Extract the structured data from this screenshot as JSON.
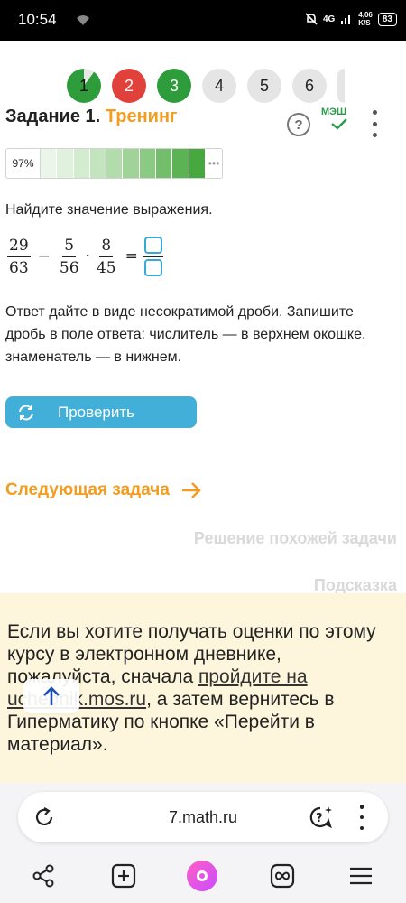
{
  "status_bar": {
    "time": "10:54",
    "network": "4G",
    "speed_top": "4,06",
    "speed_bottom": "K/S",
    "battery": "83"
  },
  "task_nav": {
    "items": [
      {
        "label": "1",
        "state": "current-partial"
      },
      {
        "label": "2",
        "state": "wrong"
      },
      {
        "label": "3",
        "state": "correct"
      },
      {
        "label": "4",
        "state": "pending"
      },
      {
        "label": "5",
        "state": "pending"
      },
      {
        "label": "6",
        "state": "pending"
      }
    ]
  },
  "header": {
    "task_label": "Задание 1.",
    "mode_label": "Тренинг",
    "help_symbol": "?",
    "badge_label": "МЭШ"
  },
  "progress": {
    "label": "97%",
    "value": 0.97,
    "cell_colors": [
      "#eaf6ea",
      "#e0f1de",
      "#d3ebcf",
      "#c4e4bf",
      "#b2dcac",
      "#9fd398",
      "#8bca83",
      "#72be6a",
      "#5bb353",
      "#46a83f"
    ],
    "more": "•••"
  },
  "task": {
    "prompt": "Найдите значение выражения.",
    "expression": {
      "f1_num": "29",
      "f1_den": "63",
      "op1": "−",
      "f2_num": "5",
      "f2_den": "56",
      "op2": "·",
      "f3_num": "8",
      "f3_den": "45",
      "eq": "="
    },
    "instructions": "Ответ дайте в виде несократимой дроби. Запишите дробь в поле ответа: числитель — в верхнем окошке, знаменатель — в нижнем."
  },
  "actions": {
    "check_label": "Проверить",
    "next_label": "Следующая задача",
    "similar_label": "Решение похожей задачи",
    "hint_label": "Подсказка"
  },
  "notice": {
    "text_before": "Если вы хотите получать оценки по этому курсу в электронном дневнике, пожалуйста, сначала ",
    "link_text": "пройдите на uchebnik.mos.ru",
    "text_after": ", а затем вернитесь в Гиперматику по кнопке «Перейти в материал»."
  },
  "browser": {
    "url": "7.math.ru"
  },
  "colors": {
    "accent_orange": "#f39c1f",
    "button_blue": "#42afd9",
    "correct_green": "#2e9c3a",
    "wrong_red": "#e0413a",
    "notice_bg": "#fdf6dc"
  }
}
